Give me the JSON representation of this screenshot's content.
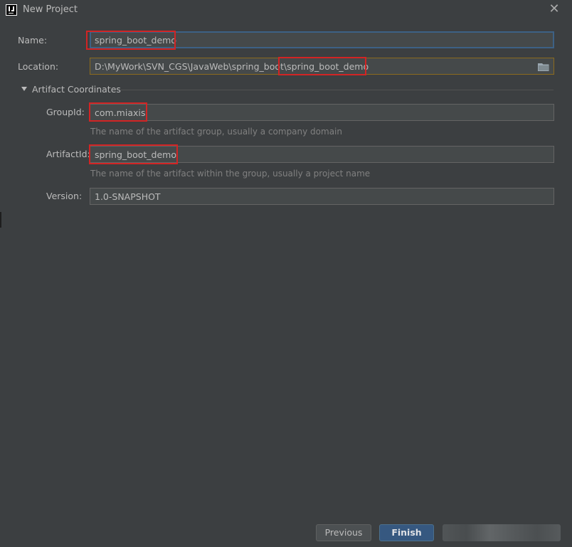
{
  "window": {
    "title": "New Project"
  },
  "form": {
    "name_label": "Name:",
    "name_value": "spring_boot_demo",
    "location_label": "Location:",
    "location_value": "D:\\MyWork\\SVN_CGS\\JavaWeb\\spring_boot\\spring_boot_demo"
  },
  "artifact": {
    "section_title": "Artifact Coordinates",
    "groupid_label": "GroupId:",
    "groupid_value": "com.miaxis",
    "groupid_hint": "The name of the artifact group, usually a company domain",
    "artifactid_label": "ArtifactId:",
    "artifactid_value": "spring_boot_demo",
    "artifactid_hint": "The name of the artifact within the group, usually a project name",
    "version_label": "Version:",
    "version_value": "1.0-SNAPSHOT"
  },
  "buttons": {
    "previous": "Previous",
    "finish": "Finish"
  },
  "icons": {
    "app": "intellij-logo-icon",
    "close": "close-icon",
    "folder": "folder-icon",
    "collapse": "triangle-down-icon"
  },
  "colors": {
    "background": "#3c3f41",
    "field_bg": "#45494a",
    "focus_border": "#3d6185",
    "highlight": "#d22424",
    "primary_button": "#365880"
  }
}
